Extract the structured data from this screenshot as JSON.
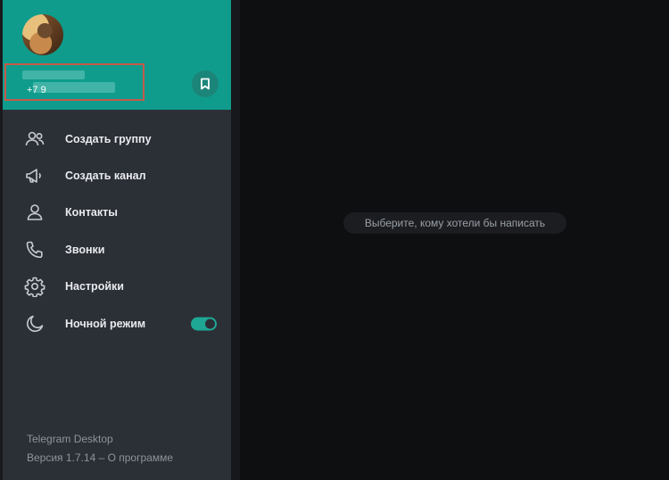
{
  "profile": {
    "phone": "+7 9"
  },
  "menu": {
    "items": [
      {
        "label": "Создать группу",
        "icon": "group-icon"
      },
      {
        "label": "Создать канал",
        "icon": "megaphone-icon"
      },
      {
        "label": "Контакты",
        "icon": "person-icon"
      },
      {
        "label": "Звонки",
        "icon": "phone-icon"
      },
      {
        "label": "Настройки",
        "icon": "gear-icon"
      },
      {
        "label": "Ночной режим",
        "icon": "moon-icon",
        "toggle_on": true
      }
    ]
  },
  "footer": {
    "app_name": "Telegram Desktop",
    "version_line": "Версия 1.7.14 – О программе"
  },
  "chat_area": {
    "empty_hint": "Выберите, кому хотели бы написать"
  },
  "colors": {
    "header_accent": "#0f9c8c",
    "drawer_bg": "#2b2f36",
    "chat_bg": "#0e0f11"
  }
}
